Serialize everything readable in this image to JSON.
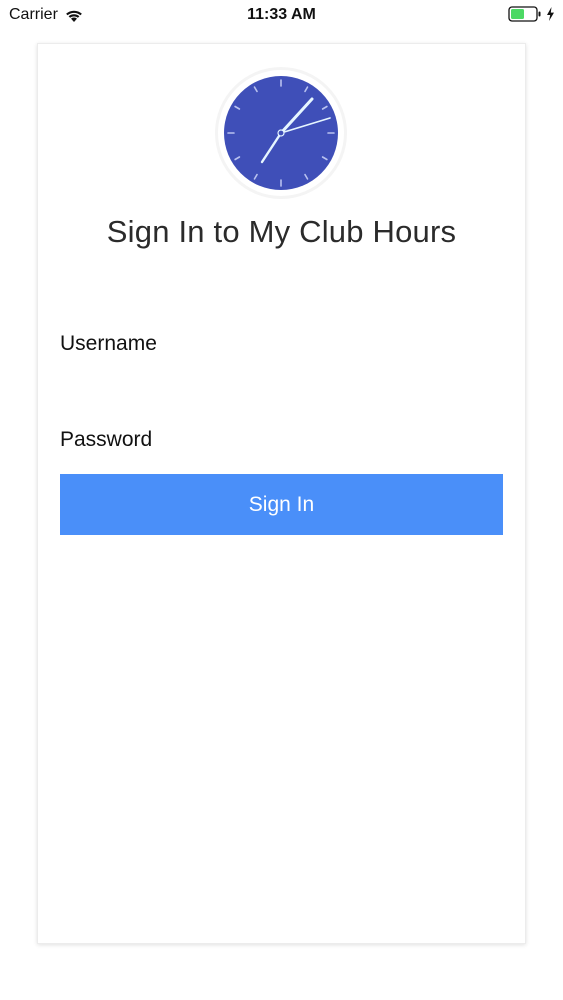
{
  "status_bar": {
    "carrier": "Carrier",
    "time": "11:33 AM",
    "icons": [
      "wifi-icon",
      "battery-icon",
      "charging-bolt-icon"
    ]
  },
  "login": {
    "title": "Sign In to My Club Hours",
    "logo_icon": "clock-logo-icon",
    "username_placeholder": "Username",
    "password_placeholder": "Password",
    "signin_label": "Sign In"
  },
  "colors": {
    "primary_button": "#4a8ff9",
    "clock_face": "#3f4fb8",
    "clock_hands": "#e6f6ff",
    "battery_fill": "#4cd964"
  }
}
